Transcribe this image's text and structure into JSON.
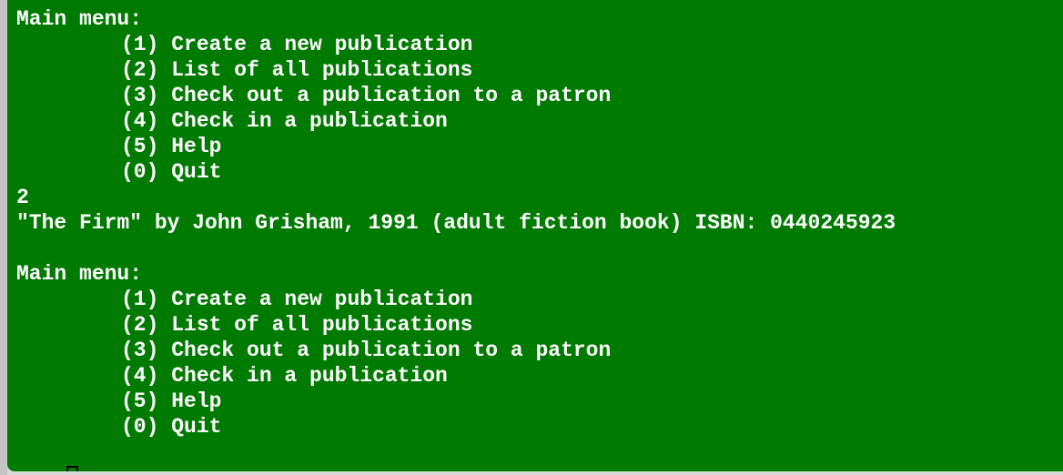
{
  "terminal": {
    "background_color": "#007a00",
    "text_color": "#ffffff",
    "menu1": {
      "title": "Main menu:",
      "items": [
        "(1) Create a new publication",
        "(2) List of all publications",
        "(3) Check out a publication to a patron",
        "(4) Check in a publication",
        "(5) Help",
        "(0) Quit"
      ]
    },
    "user_input": "2",
    "output_line": "\"The Firm\" by John Grisham, 1991 (adult fiction book) ISBN: 0440245923",
    "blank_line": "",
    "menu2": {
      "title": "Main menu:",
      "items": [
        "(1) Create a new publication",
        "(2) List of all publications",
        "(3) Check out a publication to a patron",
        "(4) Check in a publication",
        "(5) Help",
        "(0) Quit"
      ]
    },
    "cursor_icon": "block-cursor-icon"
  }
}
